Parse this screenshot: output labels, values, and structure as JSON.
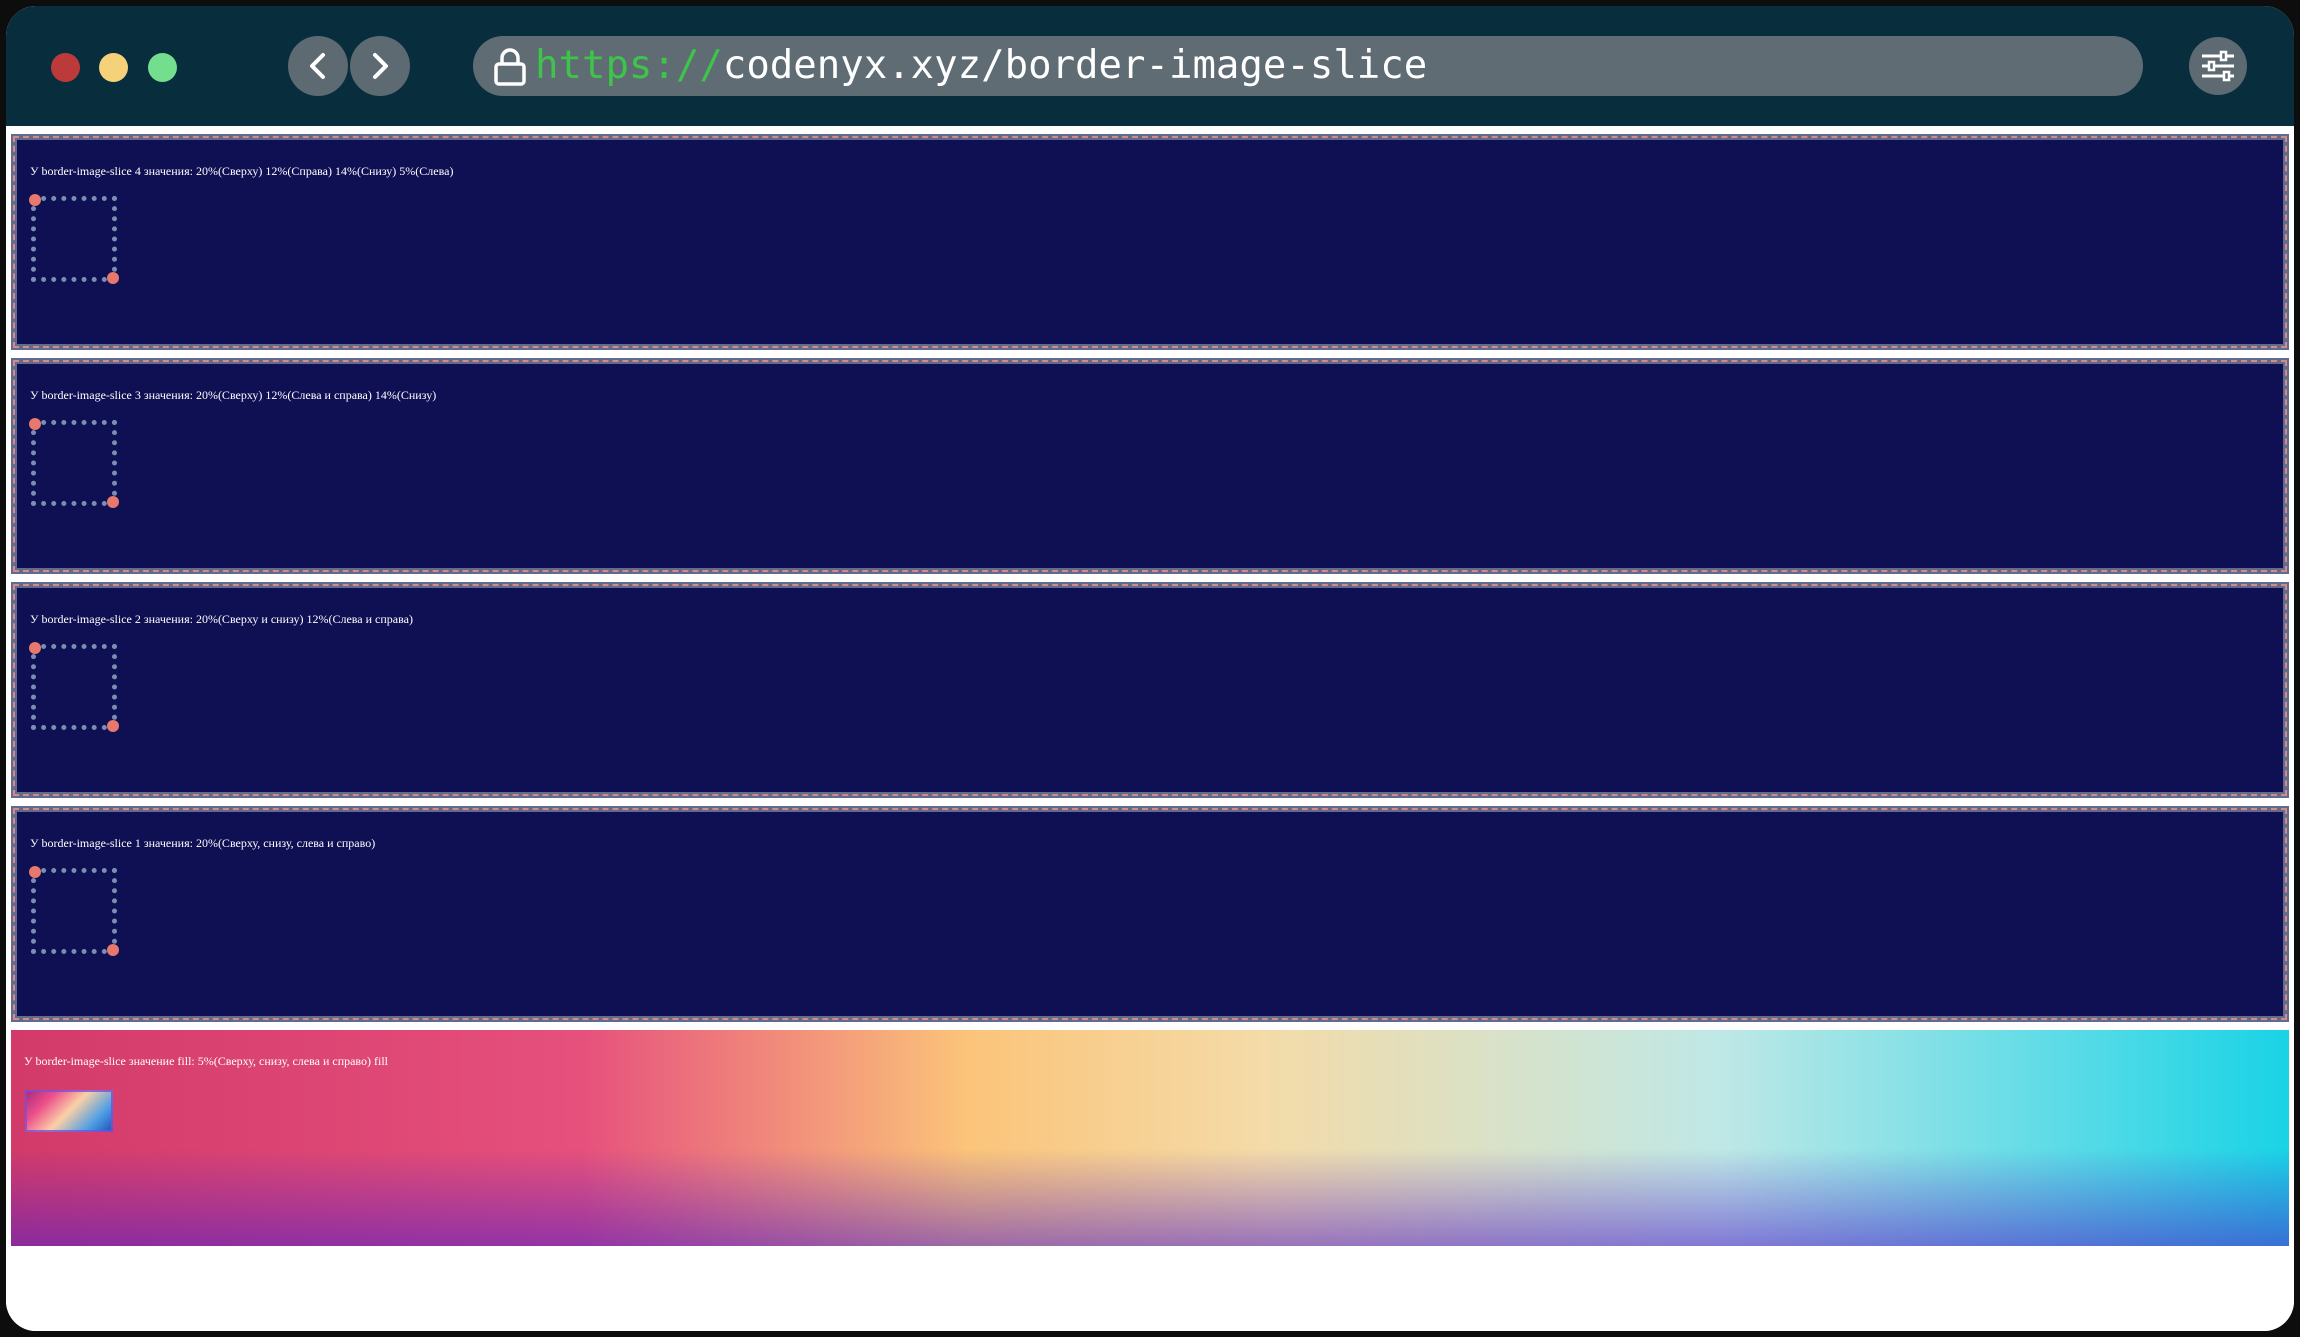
{
  "browser": {
    "url_scheme": "https://",
    "url_rest": "codenyx.xyz/border-image-slice",
    "icons": {
      "back": "chevron-left-icon",
      "forward": "chevron-right-icon",
      "lock": "lock-icon",
      "menu": "sliders-icon"
    },
    "traffic_light_colors": [
      "#bd3a3a",
      "#f5d27a",
      "#74de8f"
    ]
  },
  "page": {
    "background": "#ffffff",
    "box_background": "#0f0f54",
    "examples": [
      {
        "caption": "У border-image-slice 4 значения: 20%(Сверху) 12%(Справа) 14%(Снизу) 5%(Слева)"
      },
      {
        "caption": "У border-image-slice 3 значения: 20%(Сверху) 12%(Слева и справа) 14%(Снизу)"
      },
      {
        "caption": "У border-image-slice 2 значения: 20%(Сверху и снизу) 12%(Слева и справа)"
      },
      {
        "caption": "У border-image-slice 1 значения: 20%(Сверху, снизу, слева и справо)"
      },
      {
        "caption": "У border-image-slice значение fill: 5%(Сверху, снизу, слева и справо) fill"
      }
    ]
  }
}
